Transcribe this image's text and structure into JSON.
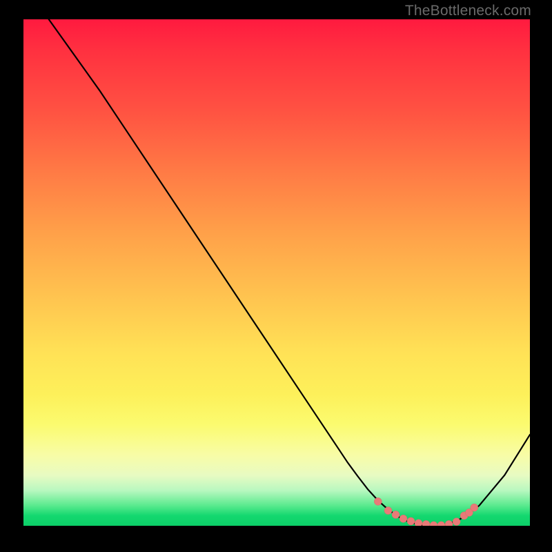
{
  "watermark": "TheBottleneck.com",
  "colors": {
    "curve": "#000000",
    "marker_fill": "#e97a78",
    "marker_stroke": "#d86b69",
    "background": "#000000"
  },
  "chart_data": {
    "type": "line",
    "title": "",
    "xlabel": "",
    "ylabel": "",
    "xlim": [
      0,
      100
    ],
    "ylim": [
      0,
      100
    ],
    "grid": false,
    "axes_visible": false,
    "series": [
      {
        "name": "bottleneck-curve",
        "x": [
          5,
          10,
          15,
          20,
          25,
          30,
          35,
          40,
          45,
          50,
          55,
          60,
          62,
          64,
          66,
          68,
          70,
          72,
          74,
          76,
          78,
          80,
          82,
          84,
          86,
          88,
          90,
          95,
          100
        ],
        "y": [
          100,
          93,
          86,
          78.5,
          71,
          63.5,
          56,
          48.5,
          41,
          33.5,
          26,
          18.5,
          15.5,
          12.5,
          9.8,
          7.2,
          5,
          3.2,
          1.8,
          0.8,
          0.2,
          0,
          0.1,
          0.4,
          1.2,
          2.4,
          4,
          10,
          18
        ]
      }
    ],
    "markers": {
      "comment": "salmon dots on the flat bottom of the valley",
      "x": [
        70,
        72,
        73.5,
        75,
        76.5,
        78,
        79.5,
        81,
        82.5,
        84,
        85.5,
        87,
        88,
        89
      ],
      "y": [
        4.8,
        3.0,
        2.2,
        1.4,
        0.9,
        0.5,
        0.3,
        0.1,
        0.1,
        0.3,
        0.8,
        2.0,
        2.6,
        3.6
      ]
    },
    "gradient_stops": [
      {
        "pos": 0.0,
        "color": "#ff1a3f"
      },
      {
        "pos": 0.06,
        "color": "#ff3040"
      },
      {
        "pos": 0.18,
        "color": "#ff5242"
      },
      {
        "pos": 0.3,
        "color": "#ff7a45"
      },
      {
        "pos": 0.42,
        "color": "#ffa049"
      },
      {
        "pos": 0.56,
        "color": "#ffc750"
      },
      {
        "pos": 0.66,
        "color": "#ffe256"
      },
      {
        "pos": 0.74,
        "color": "#fdf05a"
      },
      {
        "pos": 0.8,
        "color": "#fbfb6f"
      },
      {
        "pos": 0.86,
        "color": "#f8fca6"
      },
      {
        "pos": 0.9,
        "color": "#e8fbc2"
      },
      {
        "pos": 0.93,
        "color": "#b9f8c0"
      },
      {
        "pos": 0.96,
        "color": "#5aea8e"
      },
      {
        "pos": 0.98,
        "color": "#14d86f"
      },
      {
        "pos": 1.0,
        "color": "#0ccf68"
      }
    ]
  }
}
